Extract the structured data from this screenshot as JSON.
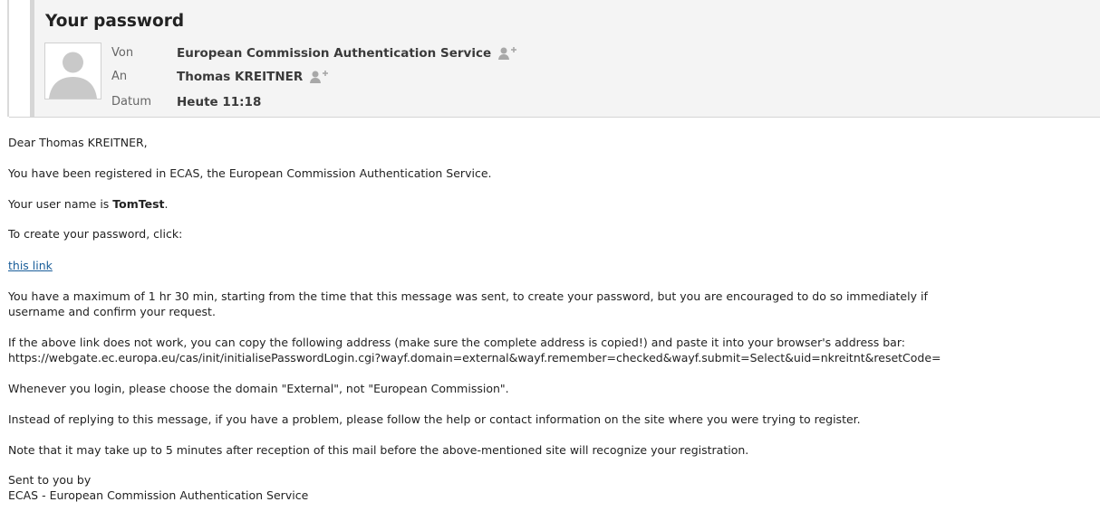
{
  "header": {
    "subject": "Your password",
    "from_label": "Von",
    "from_value": "European Commission Authentication Service",
    "to_label": "An",
    "to_value": "Thomas KREITNER",
    "date_label": "Datum",
    "date_value": "Heute 11:18",
    "add_contact_icon": "add-contact-icon",
    "avatar_icon": "person-silhouette"
  },
  "body": {
    "greeting": "Dear Thomas KREITNER,",
    "registered": "You have been registered in ECAS, the European Commission Authentication Service.",
    "username_prefix": "Your user name is ",
    "username": "TomTest",
    "username_suffix": ".",
    "create_prompt": "To create your password, click:",
    "link_text": "this link",
    "max_time_line1": "You have a maximum of 1 hr 30 min, starting from the time that this message was sent, to create your password, but you are encouraged to do so immediately if",
    "max_time_line2": "username and confirm your request.",
    "copy_line1": "If the above link does not work, you can copy the following address (make sure the complete address is copied!) and paste it into your browser's address bar:",
    "copy_url": "https://webgate.ec.europa.eu/cas/init/initialisePasswordLogin.cgi?wayf.domain=external&wayf.remember=checked&wayf.submit=Select&uid=nkreitnt&resetCode=",
    "domain_note": "Whenever you login, please choose the domain \"External\", not \"European Commission\".",
    "reply_note": "Instead of replying to this message, if you have a problem, please follow the help or contact information on the site where you were trying to register.",
    "delay_note": "Note that it may take up to 5 minutes after reception of this mail before the above-mentioned site will recognize your registration.",
    "sent_by": "Sent to you by",
    "signature": "ECAS - European Commission Authentication Service"
  },
  "colors": {
    "link": "#1a5e9a",
    "header_background": "#f4f4f4",
    "text": "#222222"
  }
}
